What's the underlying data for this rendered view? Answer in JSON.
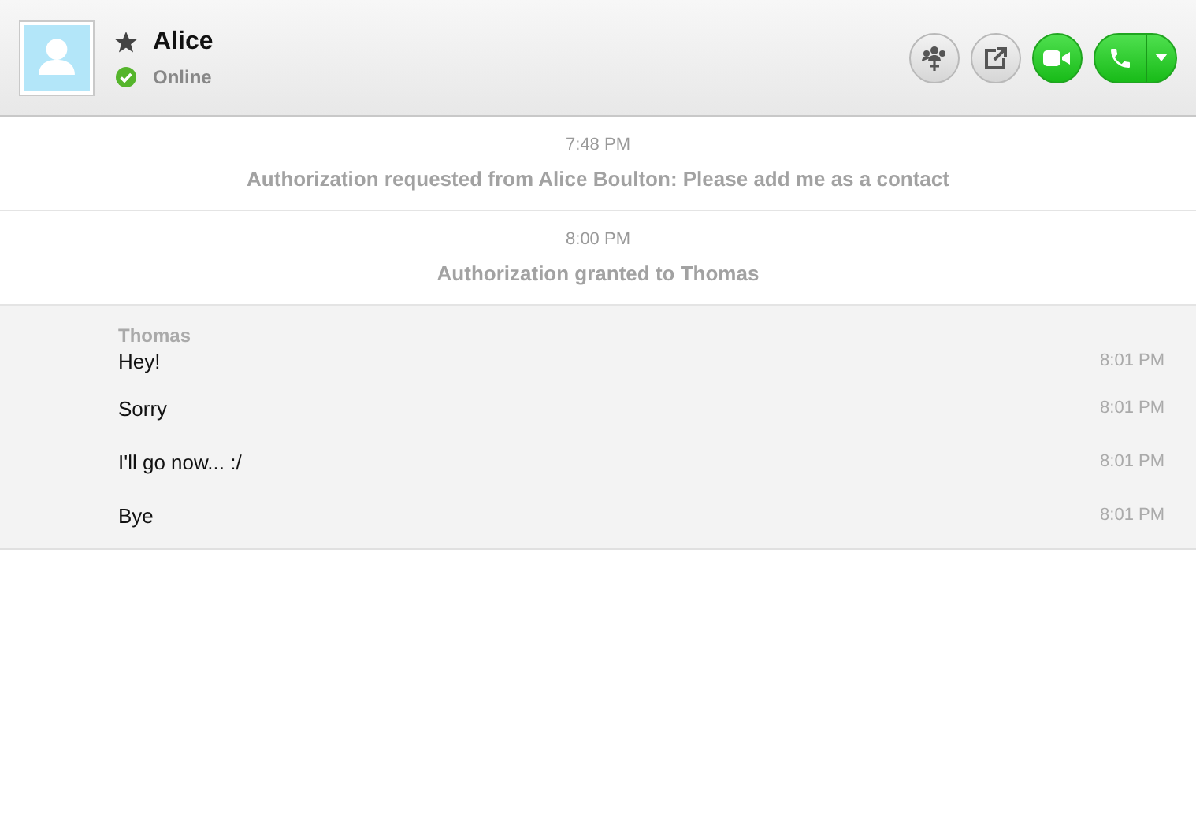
{
  "contact": {
    "name": "Alice",
    "favorite": true,
    "status": "Online"
  },
  "events": [
    {
      "time": "7:48 PM",
      "text": "Authorization requested from Alice Boulton: Please add me as a contact"
    },
    {
      "time": "8:00 PM",
      "text": "Authorization granted to Thomas"
    }
  ],
  "message_group": {
    "sender": "Thomas",
    "messages": [
      {
        "text": "Hey!",
        "time": "8:01 PM"
      },
      {
        "text": "Sorry",
        "time": "8:01 PM"
      },
      {
        "text": "I'll go now... :/",
        "time": "8:01 PM"
      },
      {
        "text": "Bye",
        "time": "8:01 PM"
      }
    ]
  }
}
